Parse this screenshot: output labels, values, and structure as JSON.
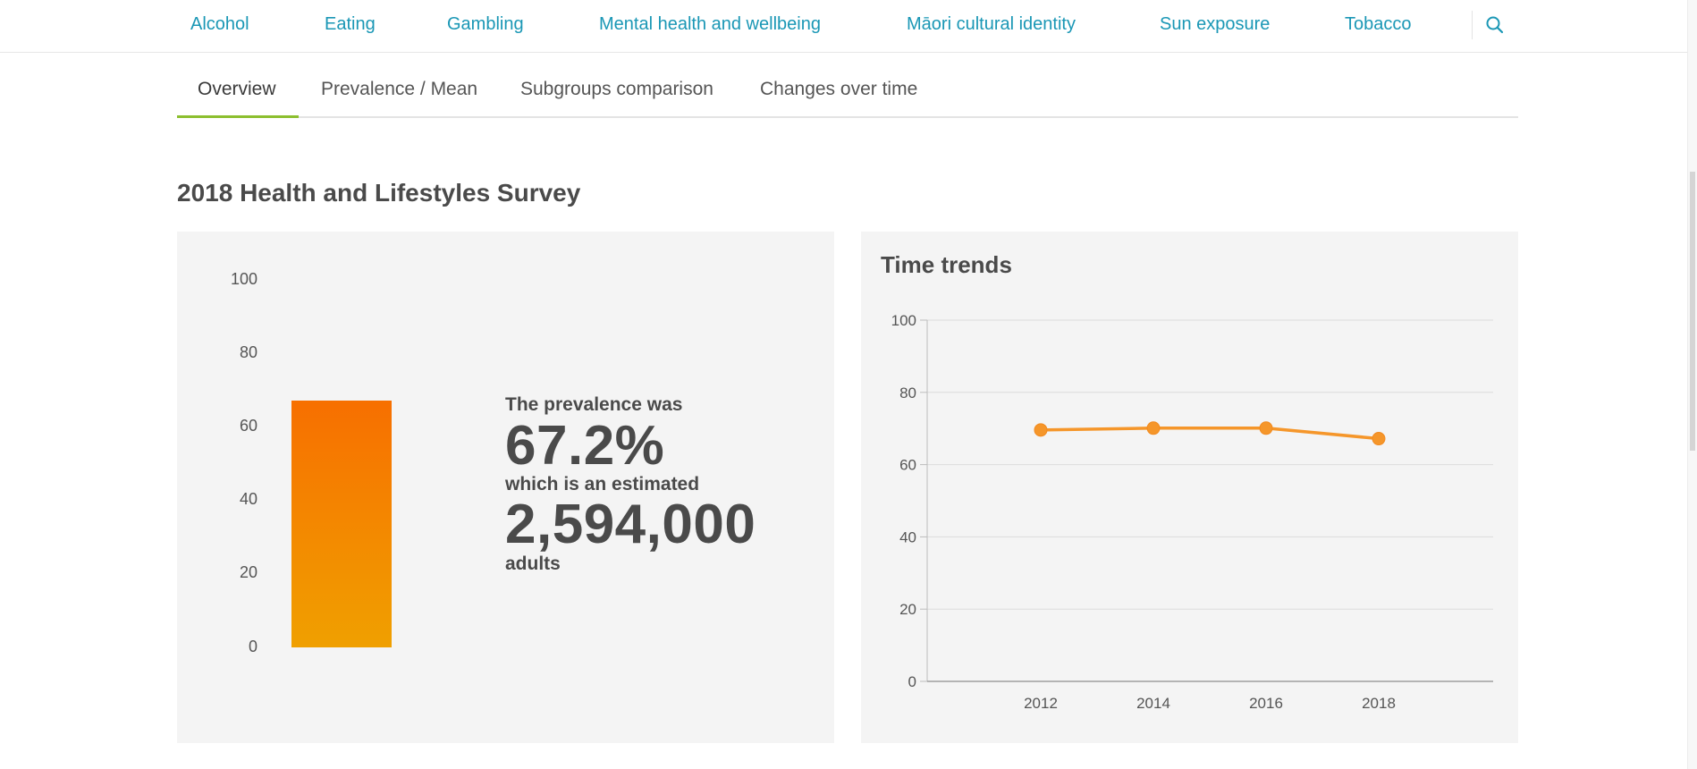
{
  "nav": {
    "items": [
      "Alcohol",
      "Eating",
      "Gambling",
      "Mental health and wellbeing",
      "Māori cultural identity",
      "Sun exposure",
      "Tobacco"
    ],
    "search_icon": "search-icon"
  },
  "tabs": [
    "Overview",
    "Prevalence / Mean",
    "Subgroups comparison",
    "Changes over time"
  ],
  "active_tab": "Overview",
  "section_title": "2018 Health and Lifestyles Survey",
  "prevalence_panel": {
    "line1": "The prevalence was",
    "percent": "67.2%",
    "line2": "which is an estimated",
    "count": "2,594,000",
    "line3": "adults"
  },
  "trend_panel": {
    "title": "Time trends"
  },
  "colors": {
    "link": "#1a97b5",
    "tab_active": "#8cbf2f",
    "bar_top": "#f76f00",
    "bar_bottom": "#f0a000",
    "line": "#f5962a",
    "panel_bg": "#f4f4f4"
  },
  "chart_data": [
    {
      "type": "bar",
      "categories": [
        ""
      ],
      "values": [
        67.2
      ],
      "ylim": [
        0,
        100
      ],
      "yticks": [
        0,
        20,
        40,
        60,
        80,
        100
      ]
    },
    {
      "type": "line",
      "title": "Time trends",
      "x": [
        "2012",
        "2014",
        "2016",
        "2018"
      ],
      "values": [
        69.6,
        70.1,
        70.1,
        67.2
      ],
      "ylim": [
        0,
        100
      ],
      "yticks": [
        0,
        20,
        40,
        60,
        80,
        100
      ],
      "grid": true
    }
  ]
}
